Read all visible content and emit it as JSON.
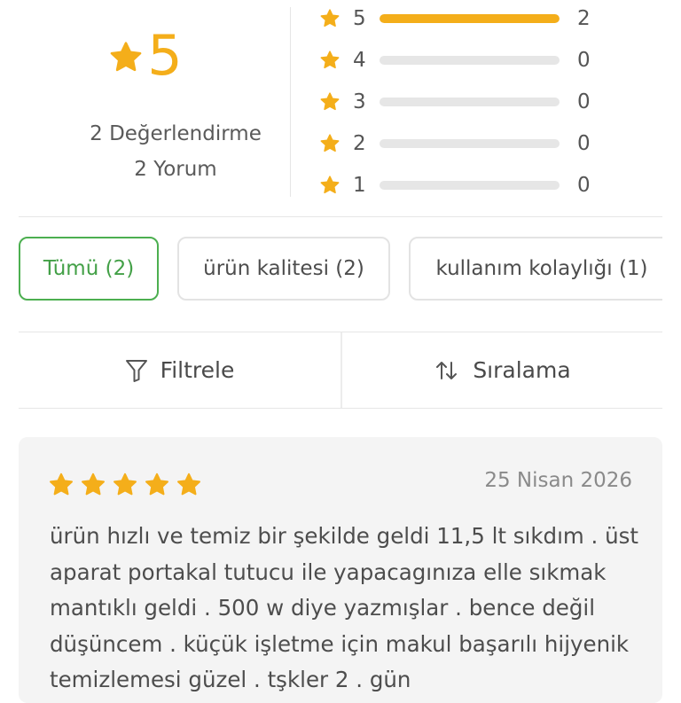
{
  "summary": {
    "average": "5",
    "rating_count": "2 Değerlendirme",
    "review_count": "2 Yorum",
    "distribution": [
      {
        "stars": "5",
        "count": "2",
        "fraction": 1.0
      },
      {
        "stars": "4",
        "count": "0",
        "fraction": 0
      },
      {
        "stars": "3",
        "count": "0",
        "fraction": 0
      },
      {
        "stars": "2",
        "count": "0",
        "fraction": 0
      },
      {
        "stars": "1",
        "count": "0",
        "fraction": 0
      }
    ]
  },
  "tags": [
    {
      "label": "Tümü (2)",
      "active": true
    },
    {
      "label": "ürün kalitesi (2)",
      "active": false
    },
    {
      "label": "kullanım kolaylığı (1)",
      "active": false
    }
  ],
  "toolbar": {
    "filter_label": "Filtrele",
    "sort_label": "Sıralama",
    "filter_icon": "funnel-icon",
    "sort_icon": "sort-arrows-icon"
  },
  "review": {
    "rating": 5,
    "date": "25 Nisan 2026",
    "text": "ürün hızlı ve temiz bir şekilde geldi 11,5 lt sıkdım . üst aparat portakal tutucu ile yapacagınıza elle sıkmak mantıklı geldi . 500 w diye yazmışlar . bence değil düşüncem . küçük işletme için makul başarılı hijyenik temizlemesi güzel . tşkler 2 . gün"
  },
  "colors": {
    "accent": "#f4ae1a",
    "active_tag": "#4caf50",
    "track": "#e6e6e6",
    "card_bg": "#f4f4f4"
  }
}
